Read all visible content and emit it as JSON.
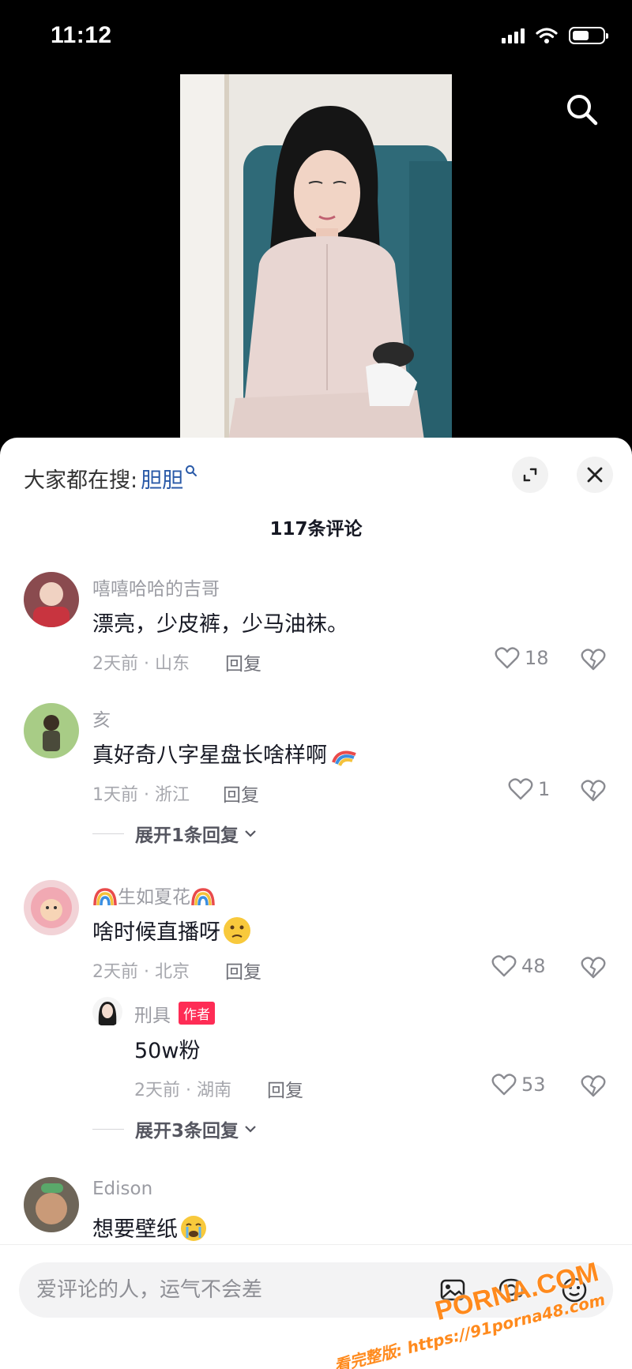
{
  "status_bar": {
    "time": "11:12"
  },
  "header": {
    "trending_label": "大家都在搜:",
    "trending_keyword": "胆胆",
    "comment_count": "117条评论"
  },
  "comments": [
    {
      "name": "嘻嘻哈哈的吉哥",
      "text": "漂亮，少皮裤，少马油袜。",
      "meta": "2天前 · 山东",
      "reply_label": "回复",
      "likes": "18"
    },
    {
      "name": "亥",
      "text": "真好奇八字星盘长啥样啊",
      "meta": "1天前 · 浙江",
      "reply_label": "回复",
      "likes": "1",
      "expand_label": "展开1条回复"
    },
    {
      "name": "生如夏花",
      "text": "啥时候直播呀",
      "meta": "2天前 · 北京",
      "reply_label": "回复",
      "likes": "48",
      "reply": {
        "name": "刑具",
        "badge": "作者",
        "text": "50w粉",
        "meta": "2天前 · 湖南",
        "reply_label": "回复",
        "likes": "53"
      },
      "expand_label": "展开3条回复"
    },
    {
      "name": "Edison",
      "text": "想要壁纸"
    }
  ],
  "input": {
    "placeholder": "爱评论的人，运气不会差"
  },
  "watermark": {
    "brand": "PORNA.COM",
    "url": "看完整版: https://91porna48.com"
  },
  "colors": {
    "accent": "#fe2c55",
    "link": "#2a5aa8",
    "watermark": "#ff8a1d"
  },
  "icons": [
    "search-icon",
    "expand-icon",
    "close-icon",
    "heart-icon",
    "broken-heart-icon",
    "chevron-down-icon",
    "image-icon",
    "at-icon",
    "emoji-icon"
  ]
}
